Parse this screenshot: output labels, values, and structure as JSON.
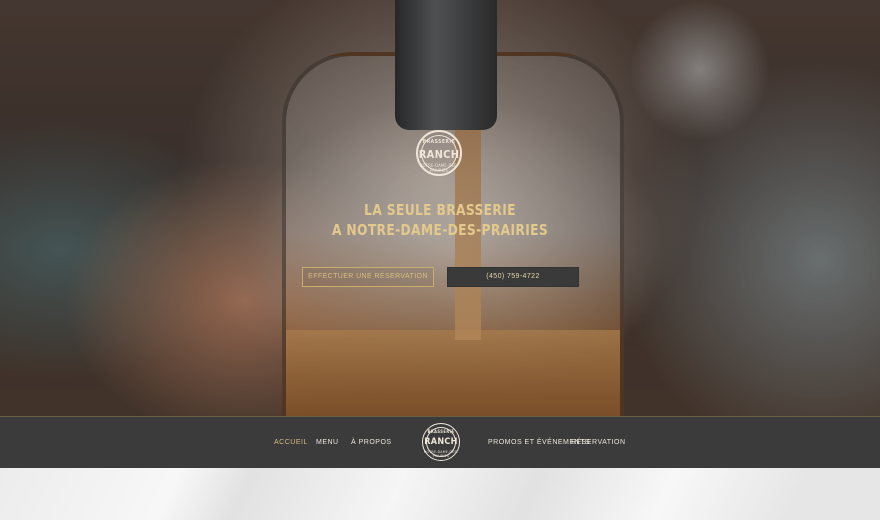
{
  "logo": {
    "top_text": "BRASSERIE",
    "main_text": "RANCH",
    "bottom_text": "NOTRE-DAME-DES-PRAIRIES"
  },
  "hero": {
    "tagline_line1": "LA SEULE BRASSERIE",
    "tagline_line2": "A NOTRE-DAME-DES-PRAIRIES",
    "reservation_button": "EFFECTUER UNE RÉSERVATION",
    "phone_button": "(450) 759-4722"
  },
  "nav": {
    "accueil": "ACCUEIL",
    "menu": "MENU",
    "a_propos": "À PROPOS",
    "promos": "PROMOS ET ÉVÉNEMENTS",
    "reservation": "RÉSERVATION"
  },
  "colors": {
    "accent_gold": "#d8bd7e",
    "nav_background": "#3b3b3c",
    "phone_button_background": "#3a3a3b"
  }
}
